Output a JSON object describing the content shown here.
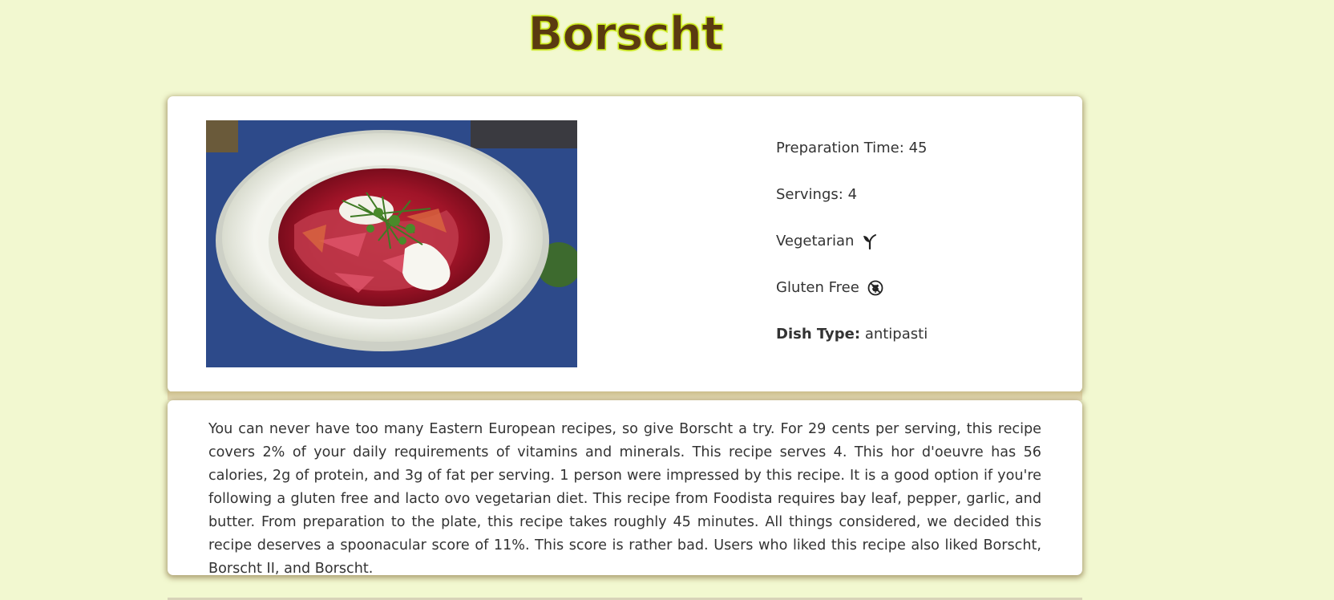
{
  "recipe": {
    "title": "Borscht",
    "image_alt": "Borscht",
    "details": {
      "preparation_label": "Preparation Time:",
      "preparation_value": "45",
      "servings_label": "Servings:",
      "servings_value": "4",
      "vegetarian_label": "Vegetarian",
      "gluten_free_label": "Gluten Free",
      "dish_type_label": "Dish Type:",
      "dish_type_value": "antipasti"
    },
    "description": "You can never have too many Eastern European recipes, so give Borscht a try. For 29 cents per serving, this recipe covers 2% of your daily requirements of vitamins and minerals. This recipe serves 4. This hor d'oeuvre has 56 calories, 2g of protein, and 3g of fat per serving. 1 person were impressed by this recipe. It is a good option if you're following a gluten free and lacto ovo vegetarian diet. This recipe from Foodista requires bay leaf, pepper, garlic, and butter. From preparation to the plate, this recipe takes roughly 45 minutes. All things considered, we decided this recipe deserves a spoonacular score of 11%. This score is rather bad. Users who liked this recipe also liked Borscht, Borscht II, and Borscht."
  },
  "icons": {
    "vegetarian": "sprout-icon",
    "gluten_free": "no-wheat-icon"
  },
  "colors": {
    "background": "#f2f8d0",
    "title_text": "#5a3a10",
    "title_outline": "#c9e81a",
    "card_background": "#ffffff",
    "card_shadow": "#785f2d"
  }
}
